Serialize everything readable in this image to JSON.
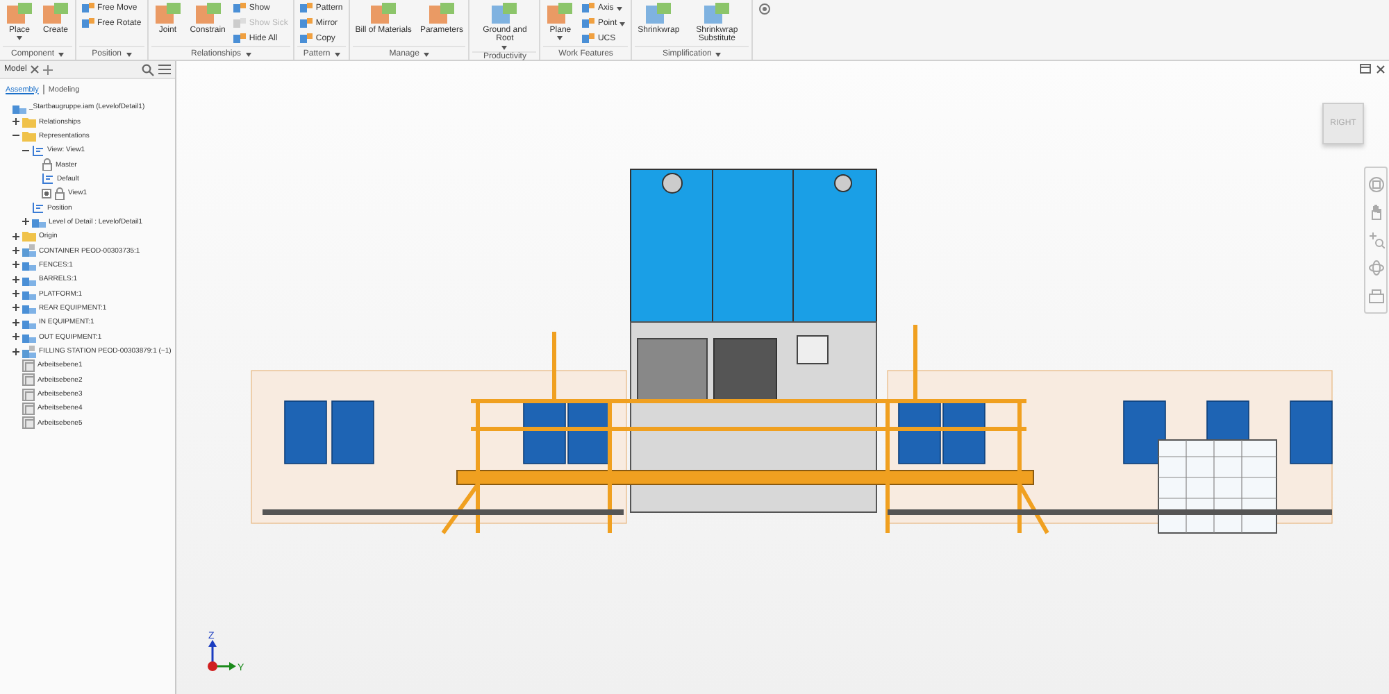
{
  "ribbon": {
    "groups": [
      {
        "label": "Component",
        "menu": true,
        "items": [
          {
            "label": "Place",
            "kind": "large",
            "menu": true,
            "disabled": false
          },
          {
            "label": "Create",
            "kind": "large",
            "menu": false,
            "disabled": false
          }
        ]
      },
      {
        "label": "Position",
        "menu": true,
        "items": [
          {
            "label": "Free Move",
            "kind": "small",
            "menu": false,
            "disabled": false
          },
          {
            "label": "Free Rotate",
            "kind": "small",
            "menu": false,
            "disabled": false
          }
        ]
      },
      {
        "label": "Relationships",
        "menu": true,
        "items": [
          {
            "label": "Joint",
            "kind": "large",
            "menu": false,
            "disabled": false
          },
          {
            "label": "Constrain",
            "kind": "large",
            "menu": false,
            "disabled": false
          },
          {
            "label": "Show",
            "kind": "small",
            "menu": false,
            "disabled": false
          },
          {
            "label": "Show Sick",
            "kind": "small",
            "menu": false,
            "disabled": true
          },
          {
            "label": "Hide All",
            "kind": "small",
            "menu": false,
            "disabled": false
          }
        ]
      },
      {
        "label": "Pattern",
        "menu": true,
        "items": [
          {
            "label": "Pattern",
            "kind": "small",
            "menu": false,
            "disabled": false
          },
          {
            "label": "Mirror",
            "kind": "small",
            "menu": false,
            "disabled": false
          },
          {
            "label": "Copy",
            "kind": "small",
            "menu": false,
            "disabled": false
          }
        ]
      },
      {
        "label": "Manage",
        "menu": true,
        "items": [
          {
            "label": "Bill of Materials",
            "kind": "large",
            "menu": false,
            "disabled": false
          },
          {
            "label": "Parameters",
            "kind": "large",
            "menu": false,
            "disabled": false
          }
        ]
      },
      {
        "label": "Productivity",
        "menu": false,
        "items": [
          {
            "label": "Ground and Root",
            "kind": "large",
            "menu": true,
            "disabled": false
          }
        ]
      },
      {
        "label": "Work Features",
        "menu": false,
        "items": [
          {
            "label": "Plane",
            "kind": "large",
            "menu": true,
            "disabled": false
          },
          {
            "label": "Axis",
            "kind": "small",
            "menu": true,
            "disabled": false
          },
          {
            "label": "Point",
            "kind": "small",
            "menu": true,
            "disabled": false
          },
          {
            "label": "UCS",
            "kind": "small",
            "menu": false,
            "disabled": false
          }
        ]
      },
      {
        "label": "Simplification",
        "menu": true,
        "items": [
          {
            "label": "Shrinkwrap",
            "kind": "large",
            "menu": false,
            "disabled": false
          },
          {
            "label": "Shrinkwrap Substitute",
            "kind": "large",
            "menu": false,
            "disabled": false
          }
        ]
      }
    ]
  },
  "browser": {
    "tab": "Model",
    "tabs": [
      {
        "label": "Assembly",
        "selected": true
      },
      {
        "label": "Modeling",
        "selected": false
      }
    ],
    "tree": [
      {
        "label": "_Startbaugruppe.iam (LevelofDetail1)",
        "kind": "assembly",
        "children": [
          {
            "label": "Relationships",
            "kind": "folder",
            "expanded": false
          },
          {
            "label": "Representations",
            "kind": "folder",
            "expanded": true,
            "children": [
              {
                "label": "View: View1",
                "kind": "view",
                "expanded": true,
                "children": [
                  {
                    "label": "Master",
                    "kind": "lock"
                  },
                  {
                    "label": "Default",
                    "kind": "view"
                  },
                  {
                    "label": "View1",
                    "kind": "lock",
                    "checkbox": true
                  }
                ]
              },
              {
                "label": "Position",
                "kind": "position"
              },
              {
                "label": "Level of Detail : LevelofDetail1",
                "kind": "assembly",
                "expanded": false
              }
            ]
          },
          {
            "label": "Origin",
            "kind": "folder",
            "expanded": false
          },
          {
            "label": "CONTAINER PEOD-00303735:1",
            "kind": "part",
            "expanded": false
          },
          {
            "label": "FENCES:1",
            "kind": "assembly",
            "expanded": false
          },
          {
            "label": "BARRELS:1",
            "kind": "assembly",
            "expanded": false
          },
          {
            "label": "PLATFORM:1",
            "kind": "assembly",
            "expanded": false
          },
          {
            "label": "REAR EQUIPMENT:1",
            "kind": "assembly",
            "expanded": false
          },
          {
            "label": "IN EQUIPMENT:1",
            "kind": "assembly",
            "expanded": false
          },
          {
            "label": "OUT EQUIPMENT:1",
            "kind": "assembly",
            "expanded": false
          },
          {
            "label": "FILLING STATION PEOD-00303879:1 (~1)",
            "kind": "part",
            "expanded": false
          },
          {
            "label": "Arbeitsebene1",
            "kind": "plane"
          },
          {
            "label": "Arbeitsebene2",
            "kind": "plane"
          },
          {
            "label": "Arbeitsebene3",
            "kind": "plane"
          },
          {
            "label": "Arbeitsebene4",
            "kind": "plane"
          },
          {
            "label": "Arbeitsebene5",
            "kind": "plane"
          }
        ]
      }
    ]
  },
  "viewcube": {
    "face": "RIGHT"
  },
  "triad": {
    "z": "Z",
    "y": "Y"
  }
}
